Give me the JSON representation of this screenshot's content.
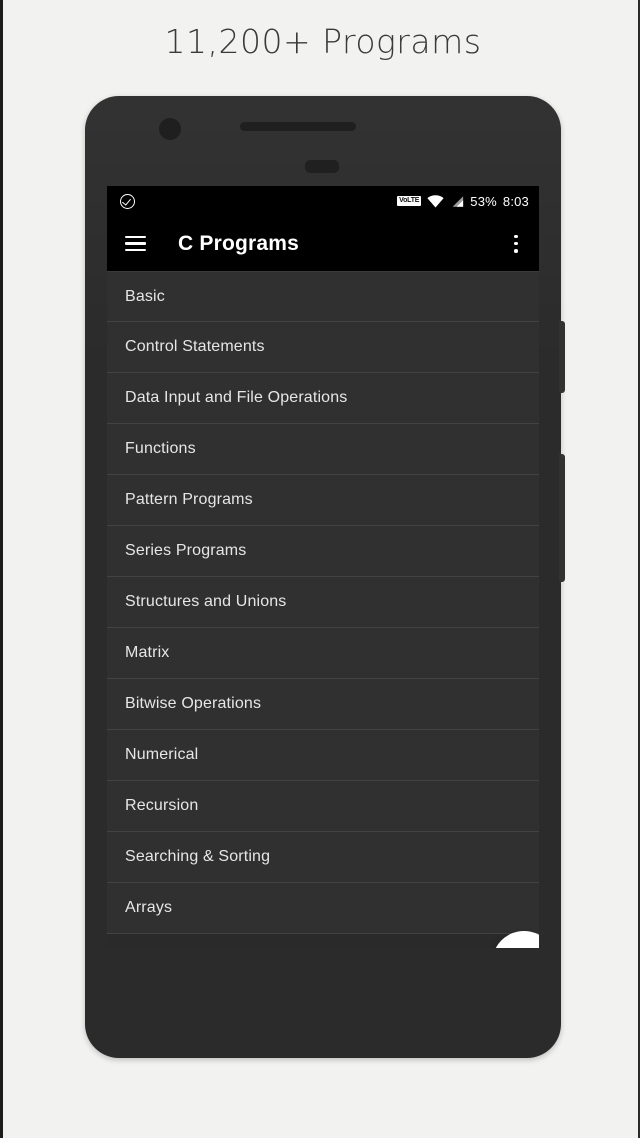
{
  "headline": "11,200+ Programs",
  "status_bar": {
    "left_icon": "check-circle-icon",
    "volte_label": "VoLTE",
    "wifi_icon": "wifi-icon",
    "signal_icon": "signal-bars-icon",
    "battery_percent": "53%",
    "clock": "8:03"
  },
  "app_bar": {
    "menu_icon": "hamburger-menu-icon",
    "title": "C Programs",
    "overflow_icon": "overflow-menu-icon"
  },
  "list": {
    "items": [
      {
        "label": "Basic"
      },
      {
        "label": "Control Statements"
      },
      {
        "label": "Data Input and File Operations"
      },
      {
        "label": "Functions"
      },
      {
        "label": "Pattern Programs"
      },
      {
        "label": "Series Programs"
      },
      {
        "label": "Structures and Unions"
      },
      {
        "label": "Matrix"
      },
      {
        "label": "Bitwise Operations"
      },
      {
        "label": "Numerical"
      },
      {
        "label": "Recursion"
      },
      {
        "label": "Searching & Sorting"
      },
      {
        "label": "Arrays"
      }
    ]
  },
  "fab": {
    "icon": "arrow-left-icon"
  },
  "colors": {
    "page_background": "#f2f2f1",
    "phone_body": "#2b2b2b",
    "status_bar": "#000000",
    "app_bar": "#000000",
    "list_row": "#303030",
    "list_divider": "#434343",
    "list_text": "#e6e6e6",
    "fab_background": "#ffffff",
    "fab_icon": "#000000",
    "headline_text": "#3a3a3a"
  }
}
